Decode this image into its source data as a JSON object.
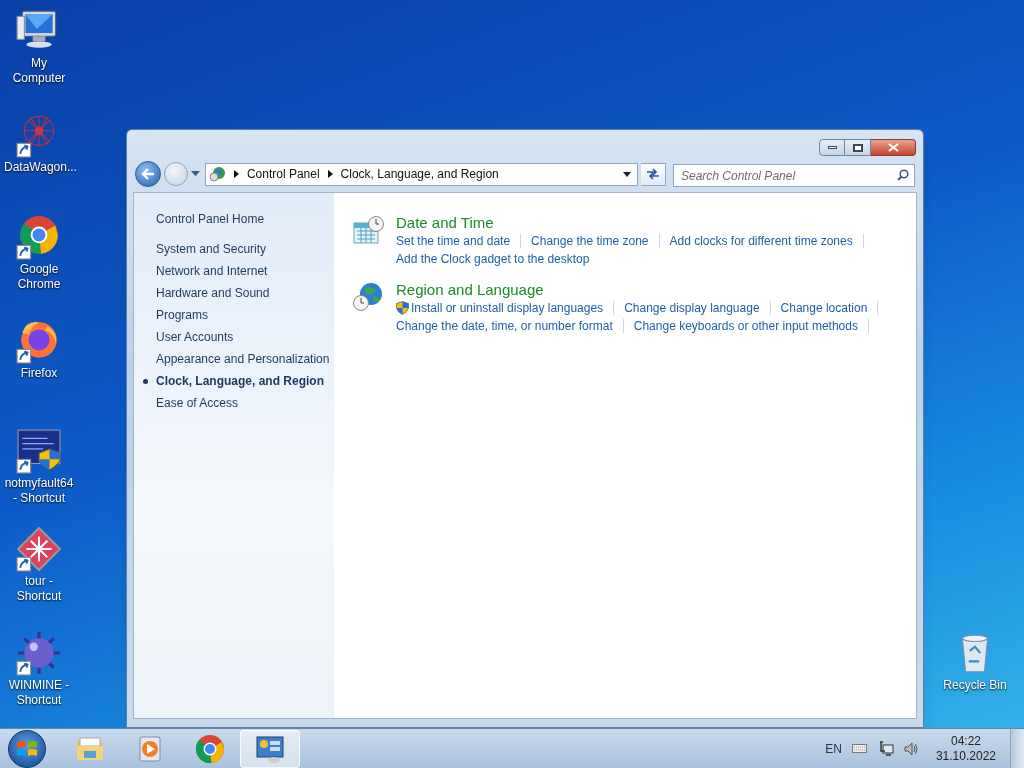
{
  "desktop_icons": [
    {
      "label": "My Computer",
      "kind": "computer",
      "shortcut": false
    },
    {
      "label": "DataWagon...",
      "kind": "datawagon",
      "shortcut": true
    },
    {
      "label": "Google Chrome",
      "kind": "chrome",
      "shortcut": true
    },
    {
      "label": "Firefox",
      "kind": "firefox",
      "shortcut": true
    },
    {
      "label": "notmyfault64 - Shortcut",
      "kind": "notmyfault",
      "shortcut": true
    },
    {
      "label": "tour - Shortcut",
      "kind": "tour",
      "shortcut": true
    },
    {
      "label": "WINMINE - Shortcut",
      "kind": "winmine",
      "shortcut": true
    },
    {
      "label": "Recycle Bin",
      "kind": "recycle",
      "shortcut": false
    }
  ],
  "window": {
    "address": [
      "Control Panel",
      "Clock, Language, and Region"
    ],
    "search": {
      "placeholder": "Search Control Panel"
    },
    "sidebar": {
      "home": "Control Panel Home",
      "items": [
        {
          "label": "System and Security",
          "selected": false
        },
        {
          "label": "Network and Internet",
          "selected": false
        },
        {
          "label": "Hardware and Sound",
          "selected": false
        },
        {
          "label": "Programs",
          "selected": false
        },
        {
          "label": "User Accounts",
          "selected": false
        },
        {
          "label": "Appearance and Personalization",
          "selected": false
        },
        {
          "label": "Clock, Language, and Region",
          "selected": true
        },
        {
          "label": "Ease of Access",
          "selected": false
        }
      ]
    },
    "sections": [
      {
        "title": "Date and Time",
        "kind": "clock",
        "rows": [
          [
            {
              "text": "Set the time and date"
            },
            {
              "text": "Change the time zone"
            },
            {
              "text": "Add clocks for different time zones"
            }
          ],
          [
            {
              "text": "Add the Clock gadget to the desktop"
            }
          ]
        ]
      },
      {
        "title": "Region and Language",
        "kind": "globe",
        "rows": [
          [
            {
              "text": "Install or uninstall display languages",
              "shield": true
            },
            {
              "text": "Change display language"
            },
            {
              "text": "Change location"
            }
          ],
          [
            {
              "text": "Change the date, time, or number format"
            },
            {
              "text": "Change keyboards or other input methods"
            }
          ]
        ]
      }
    ]
  },
  "taskbar": {
    "items": [
      {
        "kind": "explorer",
        "active": false
      },
      {
        "kind": "media",
        "active": false
      },
      {
        "kind": "chrome",
        "active": false
      },
      {
        "kind": "controlpanel",
        "active": true
      }
    ],
    "language": "EN",
    "time": "04:22",
    "date": "31.10.2022"
  }
}
